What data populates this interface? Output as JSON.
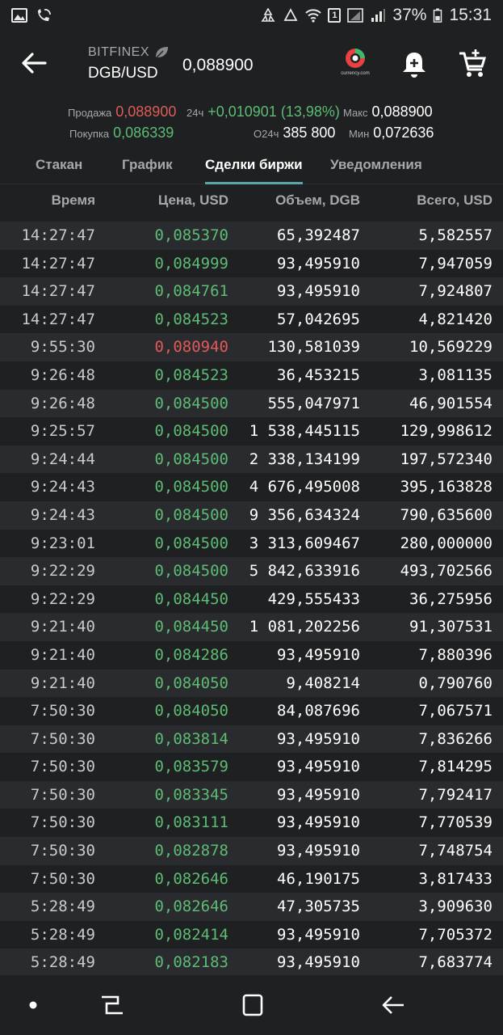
{
  "status_bar": {
    "battery": "37%",
    "time": "15:31",
    "sim_badge": "1"
  },
  "header": {
    "exchange": "BITFINEX",
    "pair": "DGB/USD",
    "price": "0,088900",
    "logo_caption": "currency.com"
  },
  "stats": {
    "sell_label": "Продажа",
    "sell_value": "0,088900",
    "buy_label": "Покупка",
    "buy_value": "0,086339",
    "change_label": "24ч",
    "change_value": "+0,010901 (13,98%)",
    "volume_label": "O24ч",
    "volume_value": "385 800",
    "max_label": "Макс",
    "max_value": "0,088900",
    "min_label": "Мин",
    "min_value": "0,072636"
  },
  "tabs": [
    {
      "label": "Стакан"
    },
    {
      "label": "График"
    },
    {
      "label": "Сделки биржи"
    },
    {
      "label": "Уведомления"
    }
  ],
  "table": {
    "headers": {
      "time": "Время",
      "price": "Цена, USD",
      "volume": "Объем, DGB",
      "total": "Всего, USD"
    },
    "rows": [
      {
        "time": "14:27:47",
        "price": "0,085370",
        "volume": "65,392487",
        "total": "5,582557",
        "side": "buy"
      },
      {
        "time": "14:27:47",
        "price": "0,084999",
        "volume": "93,495910",
        "total": "7,947059",
        "side": "buy"
      },
      {
        "time": "14:27:47",
        "price": "0,084761",
        "volume": "93,495910",
        "total": "7,924807",
        "side": "buy"
      },
      {
        "time": "14:27:47",
        "price": "0,084523",
        "volume": "57,042695",
        "total": "4,821420",
        "side": "buy"
      },
      {
        "time": "9:55:30",
        "price": "0,080940",
        "volume": "130,581039",
        "total": "10,569229",
        "side": "sell"
      },
      {
        "time": "9:26:48",
        "price": "0,084523",
        "volume": "36,453215",
        "total": "3,081135",
        "side": "buy"
      },
      {
        "time": "9:26:48",
        "price": "0,084500",
        "volume": "555,047971",
        "total": "46,901554",
        "side": "buy"
      },
      {
        "time": "9:25:57",
        "price": "0,084500",
        "volume": "1 538,445115",
        "total": "129,998612",
        "side": "buy"
      },
      {
        "time": "9:24:44",
        "price": "0,084500",
        "volume": "2 338,134199",
        "total": "197,572340",
        "side": "buy"
      },
      {
        "time": "9:24:43",
        "price": "0,084500",
        "volume": "4 676,495008",
        "total": "395,163828",
        "side": "buy"
      },
      {
        "time": "9:24:43",
        "price": "0,084500",
        "volume": "9 356,634324",
        "total": "790,635600",
        "side": "buy"
      },
      {
        "time": "9:23:01",
        "price": "0,084500",
        "volume": "3 313,609467",
        "total": "280,000000",
        "side": "buy"
      },
      {
        "time": "9:22:29",
        "price": "0,084500",
        "volume": "5 842,633916",
        "total": "493,702566",
        "side": "buy"
      },
      {
        "time": "9:22:29",
        "price": "0,084450",
        "volume": "429,555433",
        "total": "36,275956",
        "side": "buy"
      },
      {
        "time": "9:21:40",
        "price": "0,084450",
        "volume": "1 081,202256",
        "total": "91,307531",
        "side": "buy"
      },
      {
        "time": "9:21:40",
        "price": "0,084286",
        "volume": "93,495910",
        "total": "7,880396",
        "side": "buy"
      },
      {
        "time": "9:21:40",
        "price": "0,084050",
        "volume": "9,408214",
        "total": "0,790760",
        "side": "buy"
      },
      {
        "time": "7:50:30",
        "price": "0,084050",
        "volume": "84,087696",
        "total": "7,067571",
        "side": "buy"
      },
      {
        "time": "7:50:30",
        "price": "0,083814",
        "volume": "93,495910",
        "total": "7,836266",
        "side": "buy"
      },
      {
        "time": "7:50:30",
        "price": "0,083579",
        "volume": "93,495910",
        "total": "7,814295",
        "side": "buy"
      },
      {
        "time": "7:50:30",
        "price": "0,083345",
        "volume": "93,495910",
        "total": "7,792417",
        "side": "buy"
      },
      {
        "time": "7:50:30",
        "price": "0,083111",
        "volume": "93,495910",
        "total": "7,770539",
        "side": "buy"
      },
      {
        "time": "7:50:30",
        "price": "0,082878",
        "volume": "93,495910",
        "total": "7,748754",
        "side": "buy"
      },
      {
        "time": "7:50:30",
        "price": "0,082646",
        "volume": "46,190175",
        "total": "3,817433",
        "side": "buy"
      },
      {
        "time": "5:28:49",
        "price": "0,082646",
        "volume": "47,305735",
        "total": "3,909630",
        "side": "buy"
      },
      {
        "time": "5:28:49",
        "price": "0,082414",
        "volume": "93,495910",
        "total": "7,705372",
        "side": "buy"
      },
      {
        "time": "5:28:49",
        "price": "0,082183",
        "volume": "93,495910",
        "total": "7,683774",
        "side": "buy"
      }
    ]
  },
  "colors": {
    "buy": "#5dbb74",
    "sell": "#e05a5a",
    "accent": "#5aa6a8",
    "background": "#1f2022"
  }
}
